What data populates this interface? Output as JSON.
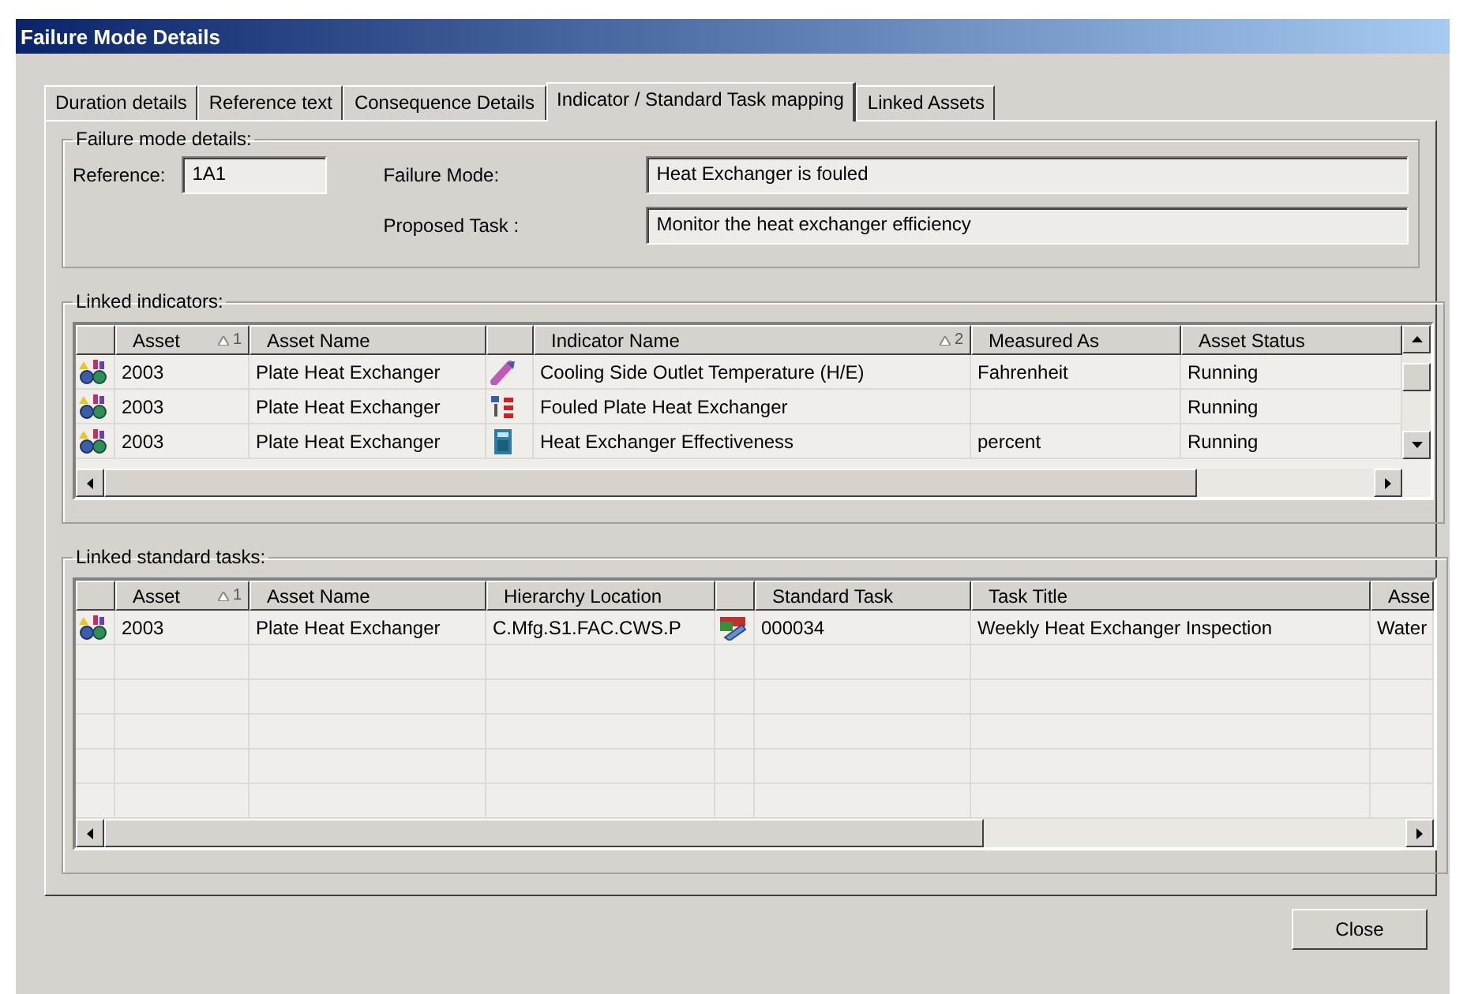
{
  "window": {
    "title": "Failure Mode Details"
  },
  "tabs": [
    {
      "label": "Duration details",
      "selected": false
    },
    {
      "label": "Reference text",
      "selected": false
    },
    {
      "label": "Consequence Details",
      "selected": false
    },
    {
      "label": "Indicator / Standard Task mapping",
      "selected": true
    },
    {
      "label": "Linked Assets",
      "selected": false
    }
  ],
  "failure_mode_details": {
    "title": "Failure mode details:",
    "reference_label": "Reference:",
    "reference": "1A1",
    "failure_mode_label": "Failure Mode:",
    "failure_mode": "Heat Exchanger is fouled",
    "proposed_task_label": "Proposed Task :",
    "proposed_task": "Monitor the heat exchanger efficiency"
  },
  "linked_indicators": {
    "title": "Linked indicators:",
    "columns": [
      {},
      {
        "label": "Asset",
        "sort": "1"
      },
      {
        "label": "Asset Name"
      },
      {},
      {
        "label": "Indicator Name",
        "sort": "2"
      },
      {
        "label": "Measured As"
      },
      {
        "label": "Asset Status"
      }
    ],
    "rows": [
      {
        "kind": "temperature",
        "asset": "2003",
        "asset_name": "Plate Heat Exchanger",
        "indicator_name": "Cooling Side Outlet Temperature (H/E)",
        "measured_as": "Fahrenheit",
        "asset_status": "Running"
      },
      {
        "kind": "list",
        "asset": "2003",
        "asset_name": "Plate Heat Exchanger",
        "indicator_name": "Fouled Plate Heat Exchanger",
        "asset_status": "Running"
      },
      {
        "kind": "calculation",
        "asset": "2003",
        "asset_name": "Plate Heat Exchanger",
        "indicator_name": "Heat Exchanger Effectiveness",
        "measured_as": "percent",
        "asset_status": "Running"
      }
    ]
  },
  "linked_standard_tasks": {
    "title": "Linked standard tasks:",
    "columns": [
      {},
      {
        "label": "Asset",
        "sort": "1"
      },
      {
        "label": "Asset Name"
      },
      {
        "label": "Hierarchy Location"
      },
      {},
      {
        "label": "Standard Task"
      },
      {
        "label": "Task Title"
      },
      {
        "label": "Asse"
      }
    ],
    "rows": [
      {
        "asset": "2003",
        "asset_name": "Plate Heat Exchanger",
        "hierarchy_location": "C.Mfg.S1.FAC.CWS.P",
        "standard_task": "000034",
        "task_title": "Weekly Heat Exchanger Inspection",
        "column_8": "Water"
      }
    ]
  },
  "buttons": [
    {
      "label": "Close"
    }
  ]
}
